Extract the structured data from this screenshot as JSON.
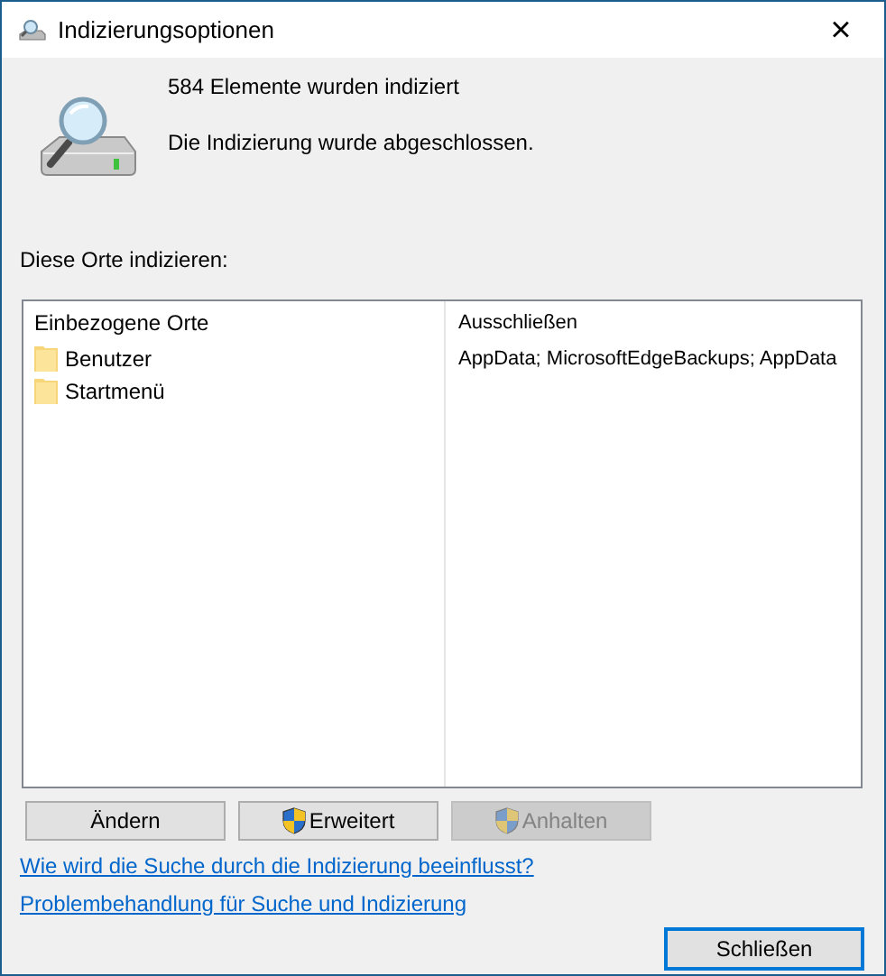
{
  "window": {
    "title": "Indizierungsoptionen",
    "close": "×"
  },
  "status": {
    "count": "584 Elemente wurden indiziert",
    "message": "Die Indizierung wurde abgeschlossen."
  },
  "locations_label": "Diese Orte indizieren:",
  "table": {
    "columns": [
      "Einbezogene Orte",
      "Ausschließen"
    ],
    "rows": [
      {
        "location": "Benutzer",
        "exclude": "AppData; MicrosoftEdgeBackups; AppData"
      },
      {
        "location": "Startmenü"
      }
    ]
  },
  "buttons": [
    {
      "label": "Ändern",
      "kind": "plain",
      "disabled": false
    },
    {
      "label": "Erweitert",
      "kind": "shield",
      "disabled": false
    },
    {
      "label": "Anhalten",
      "kind": "shield",
      "disabled": true
    }
  ],
  "links": [
    "Wie wird die Suche durch die Indizierung beeinflusst?",
    "Problembehandlung für Suche und Indizierung"
  ],
  "close_button": {
    "label": "Schließen",
    "focused": true
  }
}
